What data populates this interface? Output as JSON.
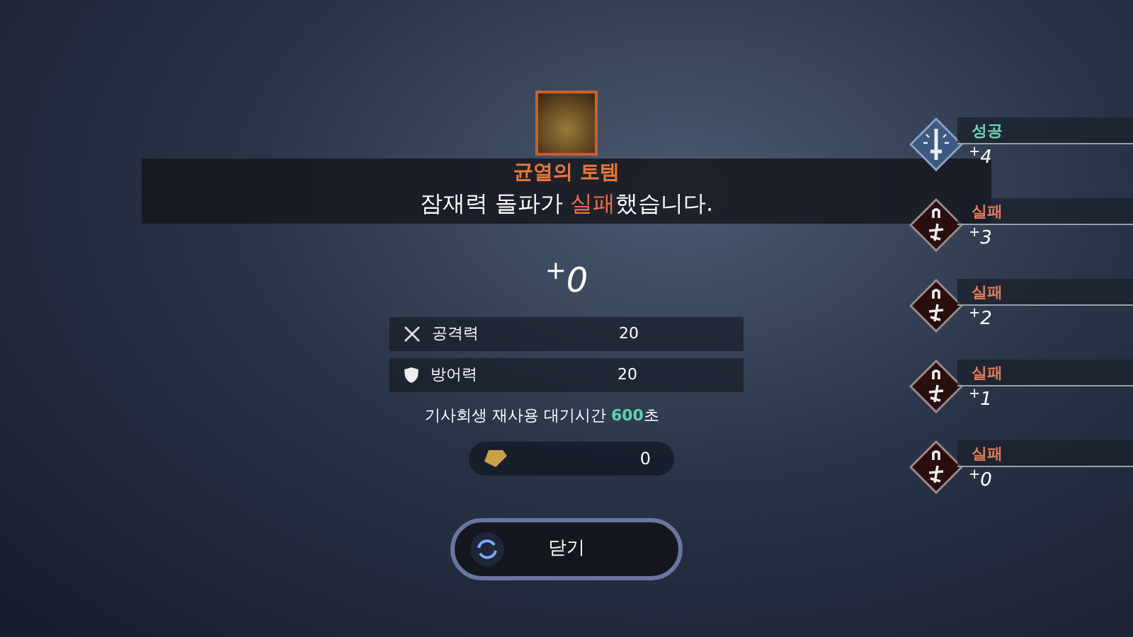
{
  "item": {
    "name": "균열의 토템",
    "message": [
      {
        "text": "잠재력 돌파가 ",
        "highlight": false
      },
      {
        "text": "실패",
        "highlight": true
      },
      {
        "text": "했습니다.",
        "highlight": false
      }
    ]
  },
  "level": "$^{+}$0",
  "stats": [
    {
      "kind": "attack",
      "label": "공격력",
      "value": "20"
    },
    {
      "kind": "defense",
      "label": "방어력",
      "value": "20"
    }
  ],
  "cooldown": [
    {
      "text": "기사회생 재사용 대기시간 ",
      "highlight": false
    },
    {
      "text": "600",
      "highlight": true
    },
    {
      "text": "초",
      "highlight": false
    }
  ],
  "cost": {
    "amount": "0"
  },
  "close_button": "닫기",
  "results": [
    {
      "kind": "success",
      "label": "성공",
      "level": "$^{+}$4"
    },
    {
      "kind": "fail",
      "label": "실패",
      "level": "$^{+}$3"
    },
    {
      "kind": "fail",
      "label": "실패",
      "level": "$^{+}$2"
    },
    {
      "kind": "fail",
      "label": "실패",
      "level": "$^{+}$1"
    },
    {
      "kind": "fail",
      "label": "실패",
      "level": "$^{+}$0"
    }
  ]
}
